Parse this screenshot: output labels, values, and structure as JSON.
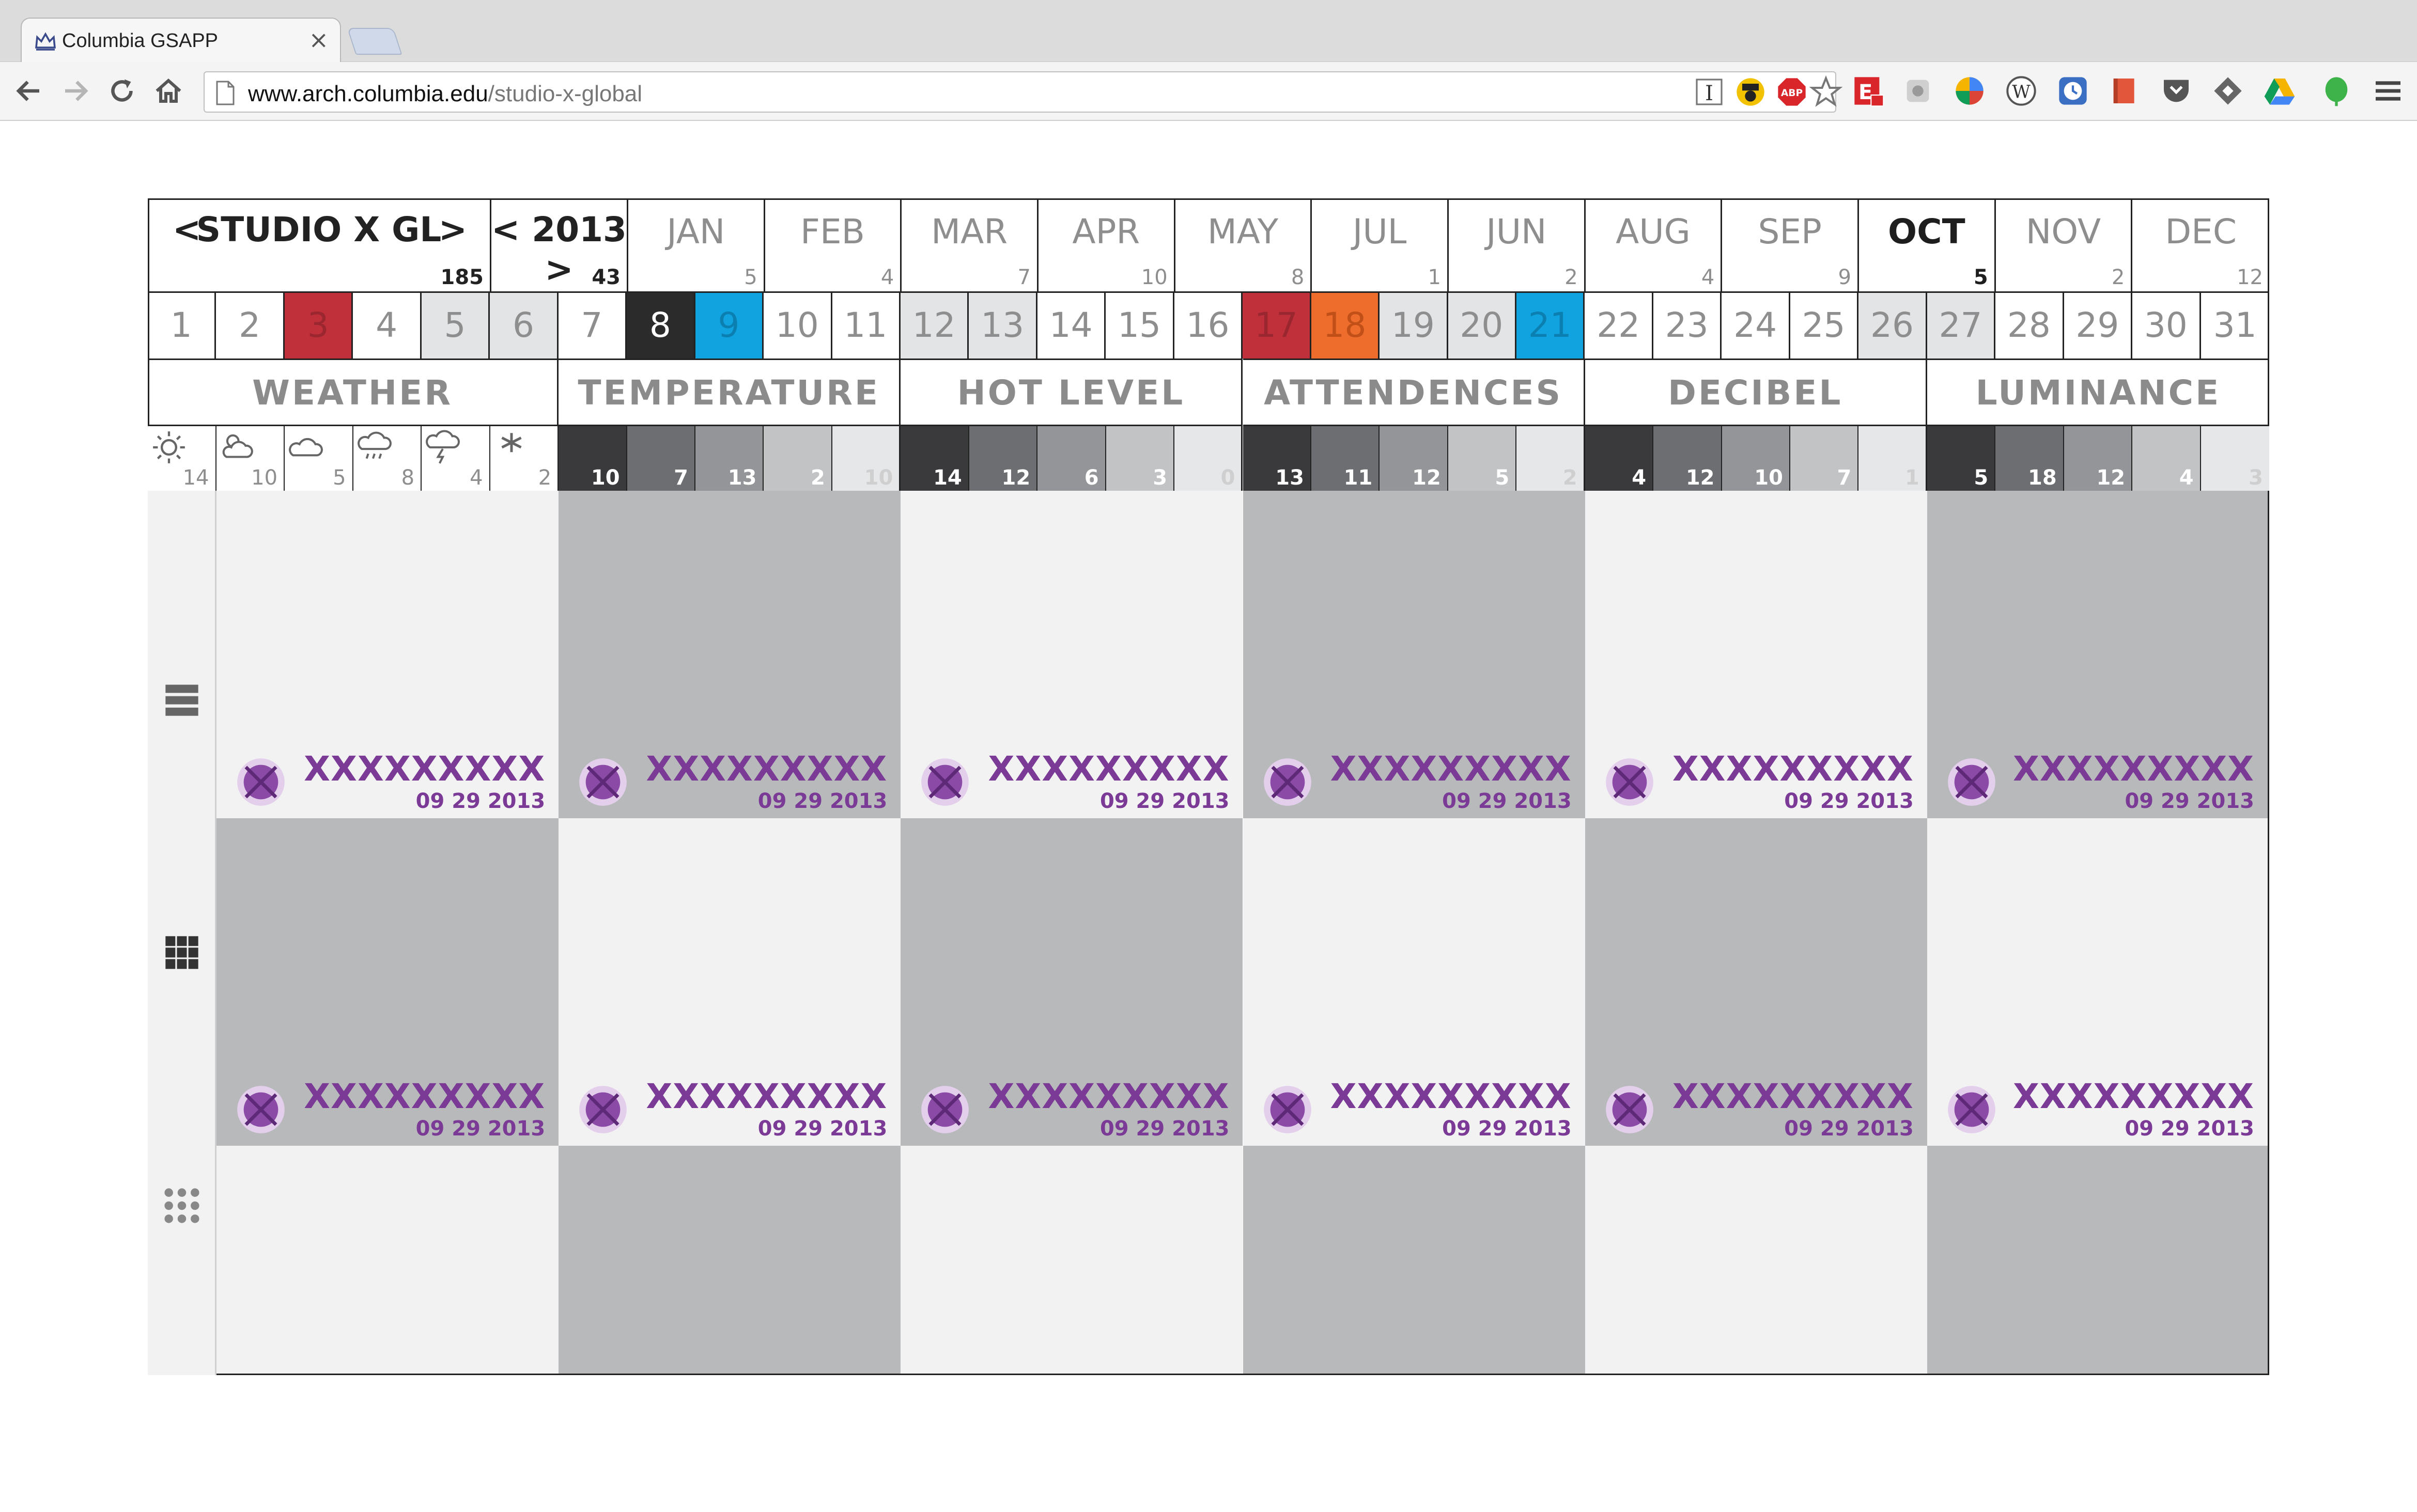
{
  "browser": {
    "tab_title": "Columbia GSAPP",
    "tab_close": "×",
    "url_host": "www.arch.columbia.edu",
    "url_path": "/studio-x-global"
  },
  "header": {
    "studio_prev": "<",
    "studio_label": "STUDIO X GL",
    "studio_next": ">",
    "studio_count": "185",
    "year_label": "< 2013 >",
    "year_count": "43",
    "months": [
      {
        "name": "JAN",
        "count": "5"
      },
      {
        "name": "FEB",
        "count": "4"
      },
      {
        "name": "MAR",
        "count": "7"
      },
      {
        "name": "APR",
        "count": "10"
      },
      {
        "name": "MAY",
        "count": "8"
      },
      {
        "name": "JUL",
        "count": "1"
      },
      {
        "name": "JUN",
        "count": "2"
      },
      {
        "name": "AUG",
        "count": "4"
      },
      {
        "name": "SEP",
        "count": "9"
      },
      {
        "name": "OCT",
        "count": "5"
      },
      {
        "name": "NOV",
        "count": "2"
      },
      {
        "name": "DEC",
        "count": "12"
      }
    ],
    "active_month": "OCT"
  },
  "days": [
    "1",
    "2",
    "3",
    "4",
    "5",
    "6",
    "7",
    "8",
    "9",
    "10",
    "11",
    "12",
    "13",
    "14",
    "15",
    "16",
    "17",
    "18",
    "19",
    "20",
    "21",
    "22",
    "23",
    "24",
    "25",
    "26",
    "27",
    "28",
    "29",
    "30",
    "31"
  ],
  "day_styles": {
    "3": {
      "bg": "#c0303a",
      "fg": "#9a2630"
    },
    "5": {
      "bg": "#e3e4e6",
      "fg": "#8e8e8e"
    },
    "6": {
      "bg": "#e3e4e6",
      "fg": "#8e8e8e"
    },
    "8": {
      "bg": "#2b2b2b",
      "fg": "#ffffff"
    },
    "9": {
      "bg": "#11a3e0",
      "fg": "#0b7fb0"
    },
    "12": {
      "bg": "#e3e4e6",
      "fg": "#8e8e8e"
    },
    "13": {
      "bg": "#e3e4e6",
      "fg": "#8e8e8e"
    },
    "17": {
      "bg": "#c0303a",
      "fg": "#9a2630"
    },
    "18": {
      "bg": "#ee6d2c",
      "fg": "#c04f18"
    },
    "19": {
      "bg": "#e3e4e6",
      "fg": "#8e8e8e"
    },
    "20": {
      "bg": "#e3e4e6",
      "fg": "#8e8e8e"
    },
    "21": {
      "bg": "#11a3e0",
      "fg": "#0b7fb0"
    },
    "26": {
      "bg": "#e3e4e6",
      "fg": "#8e8e8e"
    },
    "27": {
      "bg": "#e3e4e6",
      "fg": "#8e8e8e"
    }
  },
  "categories": [
    "WEATHER",
    "TEMPERATURE",
    "HOT LEVEL",
    "ATTENDENCES",
    "DECIBEL",
    "LUMINANCE"
  ],
  "weather": [
    {
      "icon": "sun-icon",
      "count": "14"
    },
    {
      "icon": "partly-cloudy-icon",
      "count": "10"
    },
    {
      "icon": "cloud-icon",
      "count": "5"
    },
    {
      "icon": "rain-icon",
      "count": "8"
    },
    {
      "icon": "storm-icon",
      "count": "4"
    },
    {
      "icon": "snow-icon",
      "count": "2"
    }
  ],
  "measures": [
    [
      "10",
      "7",
      "13",
      "2",
      "10"
    ],
    [
      "14",
      "12",
      "6",
      "3",
      "0"
    ],
    [
      "13",
      "11",
      "12",
      "5",
      "2"
    ],
    [
      "4",
      "12",
      "10",
      "7",
      "1"
    ],
    [
      "5",
      "18",
      "12",
      "4",
      "3"
    ]
  ],
  "swatch_colors": [
    "#3a3a3c",
    "#6d6e71",
    "#939598",
    "#c2c3c5",
    "#e6e7e8"
  ],
  "swatch_text_colors": [
    "#ffffff",
    "#ffffff",
    "#ffffff",
    "#ffffff",
    "#cfcfcf"
  ],
  "cards": {
    "title": "XXXXXXXXX",
    "date": "09 29 2013"
  },
  "views": [
    "list-view-icon",
    "grid-view-icon",
    "dots-view-icon"
  ],
  "colors": {
    "accent_purple": "#7a3a96",
    "grid_light": "#f2f2f3",
    "grid_dark": "#b8b9bb"
  }
}
